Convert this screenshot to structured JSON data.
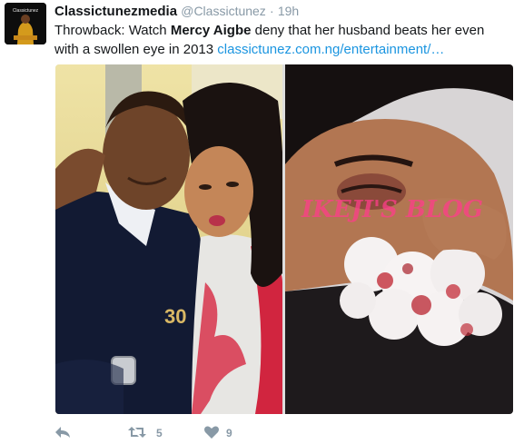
{
  "tweet": {
    "display_name": "Classictunezmedia",
    "username": "@Classictunez",
    "separator": "·",
    "time": "19h",
    "text_before": "Throwback: Watch ",
    "text_bold": "Mercy Aigbe",
    "text_after": " deny that her husband beats her even with a swollen eye in 2013 ",
    "link_text": "classictunez.com.ng/entertainment/…",
    "avatar_text": "Classictunez"
  },
  "media": {
    "watermark": "IKEJI'S BLOG",
    "shirt_number": "30"
  },
  "actions": {
    "retweet_count": "5",
    "like_count": "9"
  },
  "colors": {
    "link": "#1b95e0",
    "secondary_text": "#8899a6",
    "primary_text": "#14171a"
  }
}
